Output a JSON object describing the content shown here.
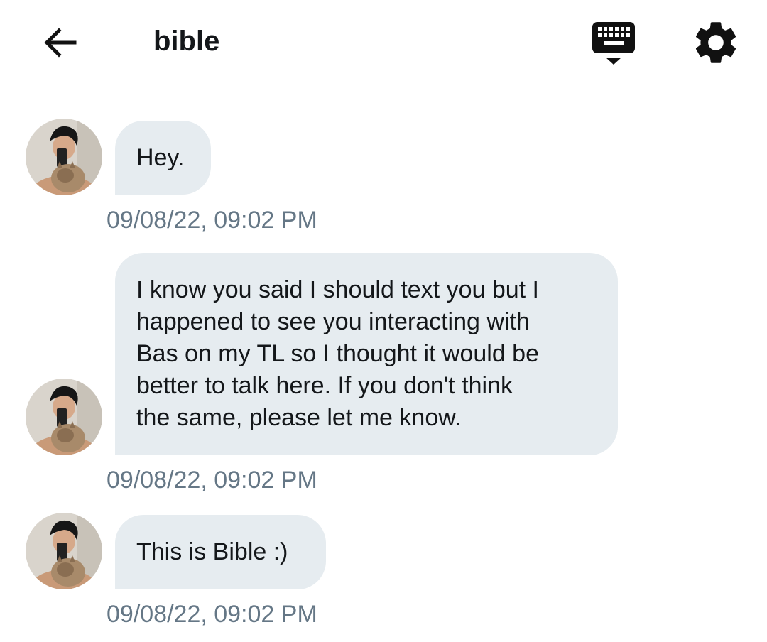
{
  "header": {
    "title": "bible",
    "back_icon": "arrow-left-icon",
    "keyboard_icon": "keyboard-hide-icon",
    "settings_icon": "gear-icon"
  },
  "colors": {
    "bubble_bg": "#e6ecf0",
    "timestamp": "#657786",
    "text": "#14171a"
  },
  "messages": [
    {
      "lines": [
        "Hey."
      ],
      "timestamp": "09/08/22, 09:02 PM"
    },
    {
      "lines": [
        "I know you said I should text you but I",
        "happened to see you interacting with",
        "Bas on my TL so I thought it would be",
        "better to talk here. If you don't think",
        "the same, please let me know."
      ],
      "timestamp": "09/08/22, 09:02 PM"
    },
    {
      "lines": [
        "This is Bible :)"
      ],
      "timestamp": "09/08/22, 09:02 PM"
    }
  ]
}
